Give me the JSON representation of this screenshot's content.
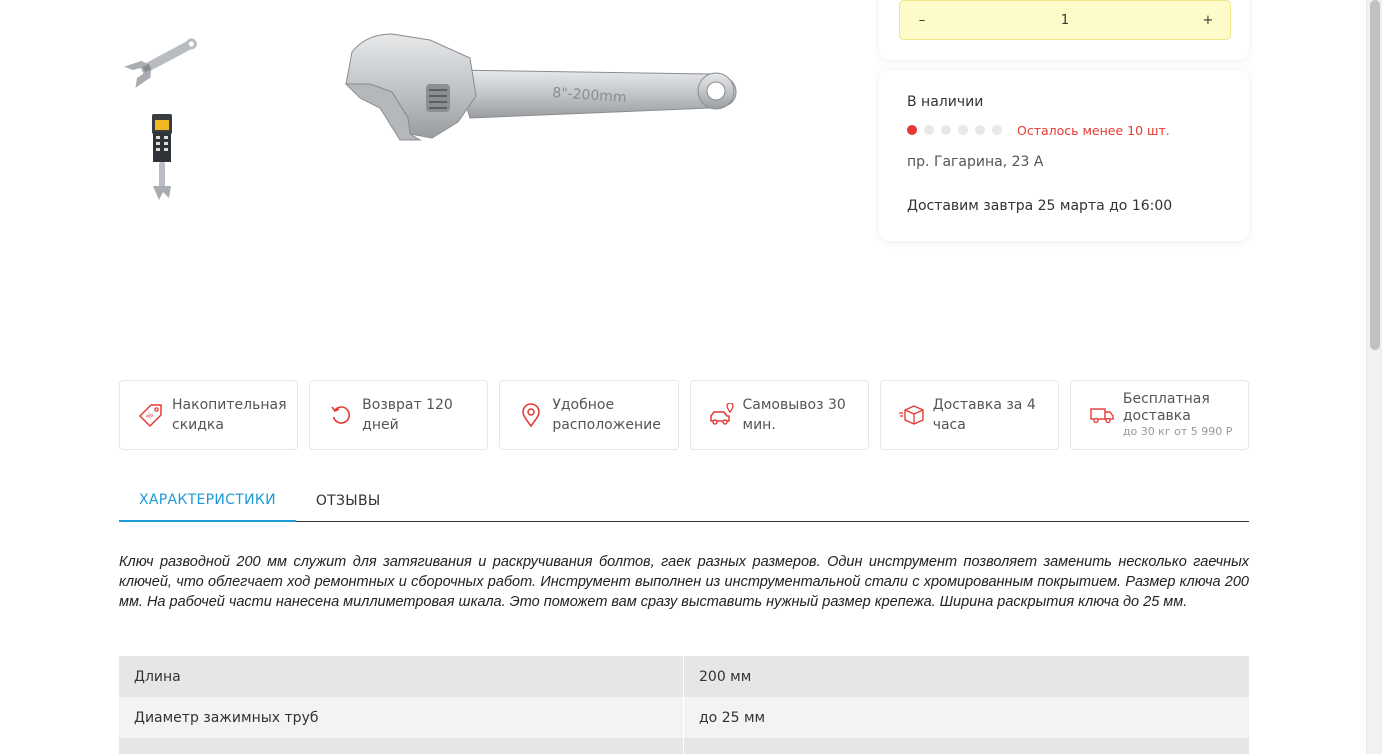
{
  "gallery": {
    "thumbnails": [
      "adjustable-wrench-thumbnail",
      "wrench-in-package-thumbnail"
    ],
    "main_image": "adjustable-wrench-image",
    "wrench_marking": "8\"-200mm"
  },
  "purchase": {
    "decrement_label": "–",
    "quantity": "1",
    "increment_label": "+"
  },
  "stock": {
    "status": "В наличии",
    "level_dots_filled": 1,
    "level_dots_total": 6,
    "warning": "Осталось менее 10 шт.",
    "address": "пр. Гагарина, 23 А",
    "delivery": "Доставим завтра 25 марта до 16:00",
    "colors": {
      "warning": "#e53935",
      "dot_off": "#e8e8e8"
    }
  },
  "features": [
    {
      "icon": "discount-tag-icon",
      "label": "Накопительная скидка"
    },
    {
      "icon": "return-icon",
      "label": "Возврат 120 дней"
    },
    {
      "icon": "location-pin-icon",
      "label": "Удобное расположение"
    },
    {
      "icon": "car-pickup-icon",
      "label": "Самовывоз 30 мин."
    },
    {
      "icon": "box-delivery-icon",
      "label": "Доставка за 4 часа"
    },
    {
      "icon": "truck-icon",
      "label": "Бесплатная доставка",
      "sublabel": "до 30 кг от 5 990 Р"
    }
  ],
  "tabs": [
    {
      "label": "ХАРАКТЕРИСТИКИ",
      "active": true
    },
    {
      "label": "ОТЗЫВЫ",
      "active": false
    }
  ],
  "description": "Ключ разводной 200 мм служит для затягивания и раскручивания болтов, гаек разных размеров. Один инструмент позволяет заменить несколько гаечных ключей, что облегчает ход ремонтных и сборочных работ. Инструмент выполнен из инструментальной стали с хромированным покрытием. Размер ключа 200 мм. На рабочей части нанесена миллиметровая шкала. Это поможет вам сразу выставить нужный размер крепежа. Ширина раскрытия ключа до 25 мм.",
  "specs": [
    {
      "name": "Длина",
      "value": "200 мм"
    },
    {
      "name": "Диаметр зажимных труб",
      "value": "до 25 мм"
    },
    {
      "name": "",
      "value": ""
    }
  ],
  "theme": {
    "accent": "#1e9ad6",
    "icon_red": "#e53935",
    "stepper_bg": "#fdfbc7"
  }
}
